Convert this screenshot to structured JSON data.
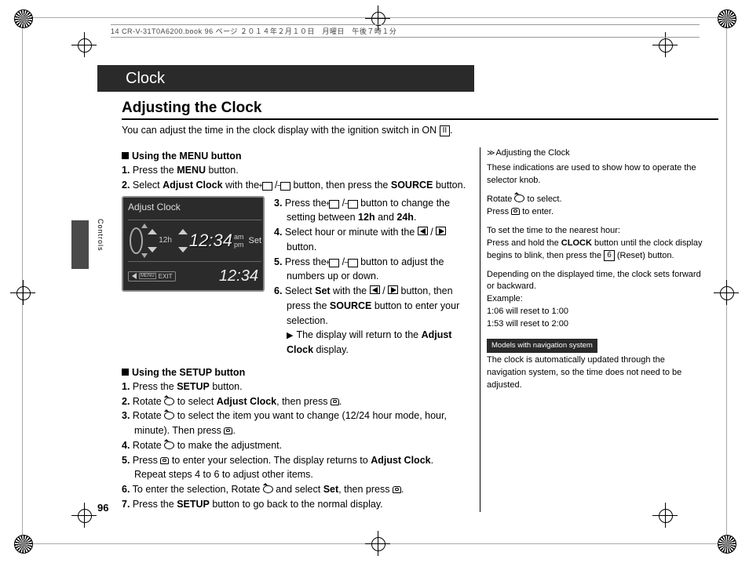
{
  "bookline": "14 CR-V-31T0A6200.book  96 ページ  ２０１４年２月１０日　月曜日　午後７時１分",
  "header": "Clock",
  "title": "Adjusting the Clock",
  "intro_a": "You can adjust the time in the clock display with the ignition switch in ON ",
  "intro_box": "II",
  "intro_b": ".",
  "side_label": "Controls",
  "page_num": "96",
  "menu_section": {
    "heading": "Using the MENU button",
    "s1_a": "1.",
    "s1_b": " Press the ",
    "s1_c": "MENU",
    "s1_d": " button.",
    "s2_a": "2.",
    "s2_b": " Select ",
    "s2_c": "Adjust Clock",
    "s2_d": " with the ",
    "s2_e": " button, then press the ",
    "s2_f": "SOURCE",
    "s2_g": " button.",
    "s3_a": "3.",
    "s3_b": " Press the ",
    "s3_c": " button to change the setting between ",
    "s3_d": "12h",
    "s3_e": " and ",
    "s3_f": "24h",
    "s3_g": ".",
    "s4_a": "4.",
    "s4_b": " Select hour or minute with the ",
    "s4_c": " button.",
    "s5_a": "5.",
    "s5_b": " Press the ",
    "s5_c": " button to adjust the numbers up or down.",
    "s6_a": "6.",
    "s6_b": " Select ",
    "s6_c": "Set",
    "s6_d": " with the ",
    "s6_e": " button, then press the ",
    "s6_f": "SOURCE",
    "s6_g": " button to enter your selection.",
    "s6_sub_a": "The display will return to the ",
    "s6_sub_b": "Adjust Clock",
    "s6_sub_c": " display."
  },
  "display": {
    "title": "Adjust Clock",
    "mode": "12h",
    "time1": "12:34",
    "ampm_top": "am",
    "ampm_bot": "pm",
    "set": "Set",
    "exit": "EXIT",
    "menu": "MENU",
    "time2": "12:34"
  },
  "setup_section": {
    "heading": "Using the SETUP button",
    "s1_a": "1.",
    "s1_b": " Press the ",
    "s1_c": "SETUP",
    "s1_d": " button.",
    "s2_a": "2.",
    "s2_b": " Rotate ",
    "s2_c": " to select ",
    "s2_d": "Adjust Clock",
    "s2_e": ", then press ",
    "s3_a": "3.",
    "s3_b": " Rotate ",
    "s3_c": " to select the item you want to change (12/24 hour mode, hour, minute). Then press ",
    "s4_a": "4.",
    "s4_b": " Rotate ",
    "s4_c": " to make the adjustment.",
    "s5_a": "5.",
    "s5_b": " Press ",
    "s5_c": " to enter your selection. The display returns to ",
    "s5_d": "Adjust Clock",
    "s5_e": ". Repeat steps 4 to 6 to adjust other items.",
    "s6_a": "6.",
    "s6_b": " To enter the selection, Rotate ",
    "s6_c": " and select ",
    "s6_d": "Set",
    "s6_e": ", then press ",
    "s7_a": "7.",
    "s7_b": " Press the ",
    "s7_c": "SETUP",
    "s7_d": " button to go back to the normal display."
  },
  "sidebar": {
    "title": "Adjusting the Clock",
    "p1": "These indications are used to show how to operate the selector knob.",
    "p2a": "Rotate ",
    "p2b": " to select.",
    "p3a": "Press ",
    "p3b": " to enter.",
    "p4": "To set the time to the nearest hour:",
    "p5a": "Press and hold the ",
    "p5b": "CLOCK",
    "p5c": " button until the clock display begins to blink, then press the ",
    "p5d": "6",
    "p5e": " (Reset) button.",
    "p6": "Depending on the displayed time, the clock sets forward or backward.",
    "p7": "Example:",
    "p8": "1:06 will reset to 1:00",
    "p9": "1:53 will reset to 2:00",
    "models": "Models with navigation system",
    "p10": "The clock is automatically updated through the navigation system, so the time does not need to be adjusted."
  }
}
